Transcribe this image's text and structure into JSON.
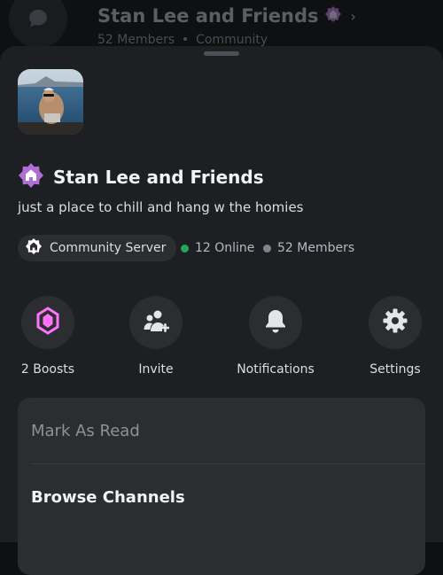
{
  "background_header": {
    "title": "Stan Lee and Friends",
    "members": "52 Members",
    "community": "Community"
  },
  "server": {
    "name": "Stan Lee and Friends",
    "description": "just a place to chill and hang w the homies",
    "community_label": "Community Server",
    "online": "12 Online",
    "members": "52 Members"
  },
  "actions": [
    {
      "label": "2 Boosts",
      "icon": "boost-icon"
    },
    {
      "label": "Invite",
      "icon": "invite-icon"
    },
    {
      "label": "Notifications",
      "icon": "bell-icon"
    },
    {
      "label": "Settings",
      "icon": "gear-icon"
    }
  ],
  "menu": [
    {
      "label": "Mark As Read"
    },
    {
      "label": "Browse Channels"
    }
  ],
  "colors": {
    "online": "#23a55a",
    "members": "#80848e",
    "boost": "#ff73fa",
    "badge": "#9b59b6"
  }
}
